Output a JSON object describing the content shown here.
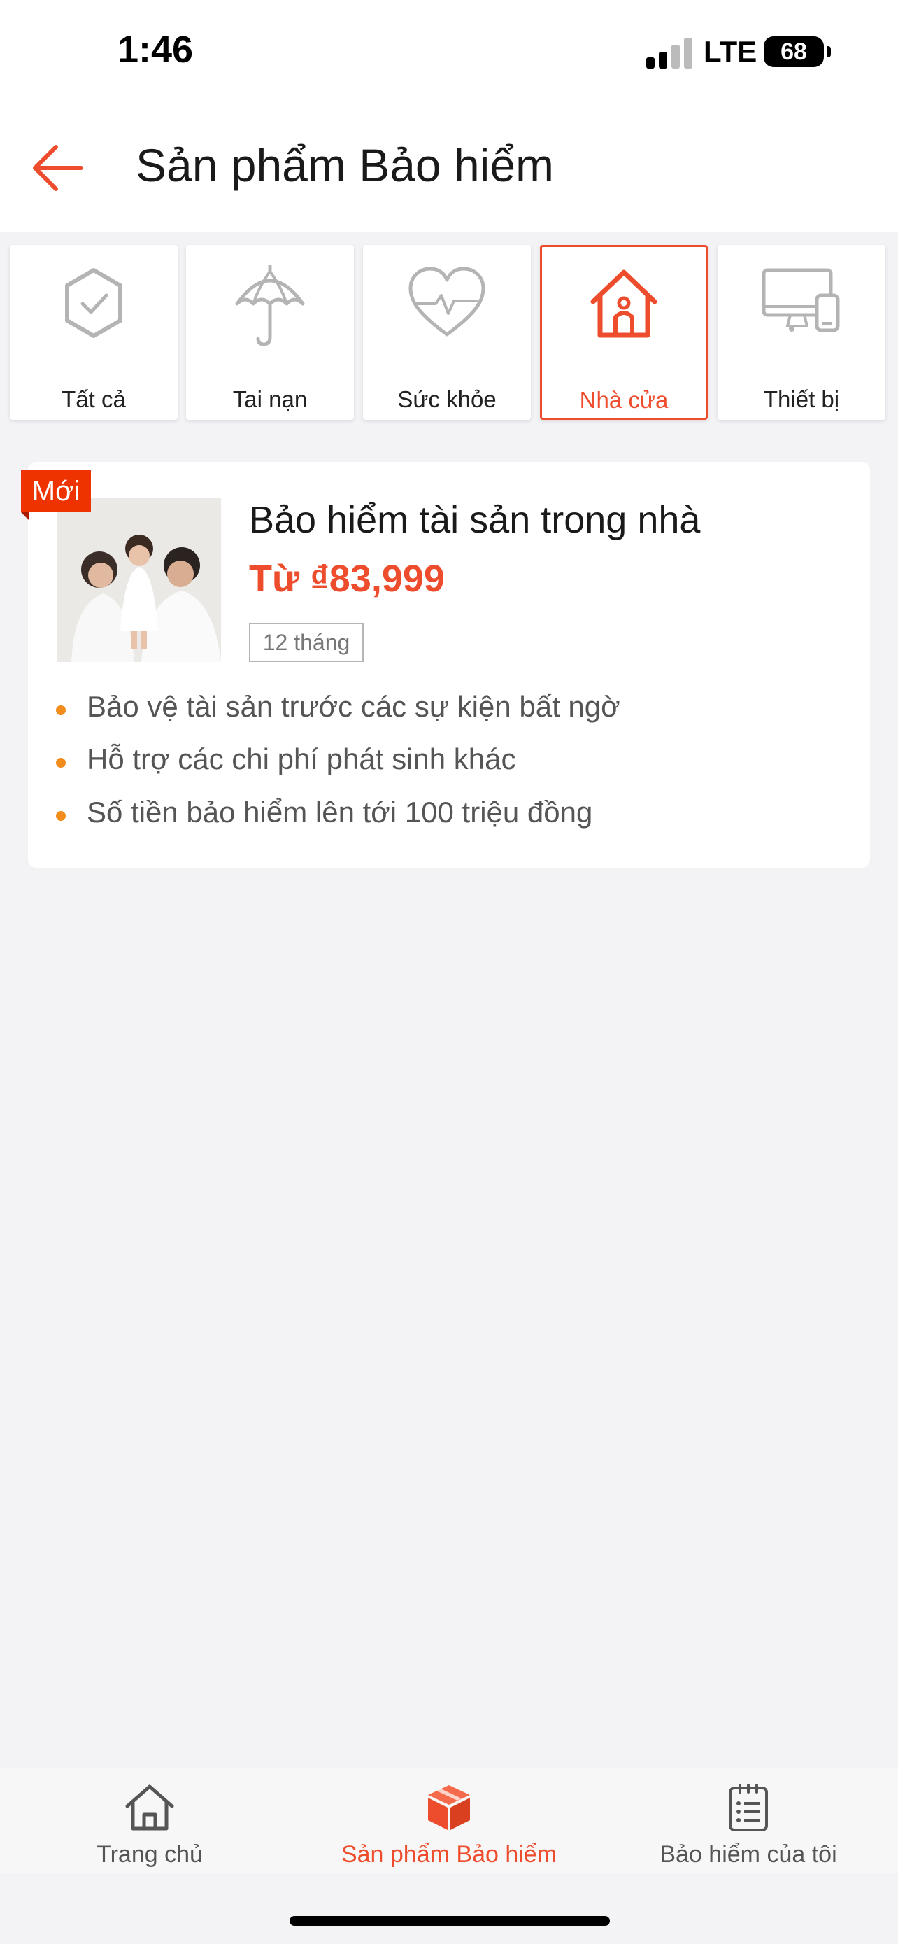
{
  "status_bar": {
    "time": "1:46",
    "network": "LTE",
    "battery": "68"
  },
  "header": {
    "title": "Sản phẩm Bảo hiểm"
  },
  "categories": [
    {
      "label": "Tất cả",
      "icon": "shield-check-icon"
    },
    {
      "label": "Tai nạn",
      "icon": "umbrella-icon"
    },
    {
      "label": "Sức khỏe",
      "icon": "heart-pulse-icon"
    },
    {
      "label": "Nhà cửa",
      "icon": "house-icon",
      "active": true
    },
    {
      "label": "Thiết bị",
      "icon": "devices-icon"
    }
  ],
  "product": {
    "badge": "Mới",
    "title": "Bảo hiểm tài sản trong nhà",
    "price": "Từ ₫83,999",
    "term": "12 tháng",
    "benefits": [
      "Bảo vệ tài sản trước các sự kiện bất ngờ",
      "Hỗ trợ các chi phí phát sinh khác",
      "Số tiền bảo hiểm lên tới 100 triệu đồng"
    ]
  },
  "bottom_nav": [
    {
      "label": "Trang chủ",
      "icon": "home-icon"
    },
    {
      "label": "Sản phẩm Bảo hiểm",
      "icon": "product-box-icon",
      "active": true
    },
    {
      "label": "Bảo hiểm của tôi",
      "icon": "clipboard-list-icon"
    }
  ],
  "colors": {
    "accent": "#ee4d2d",
    "bullet": "#f28c1c",
    "badge": "#ee3300",
    "background": "#f3f2f5"
  }
}
